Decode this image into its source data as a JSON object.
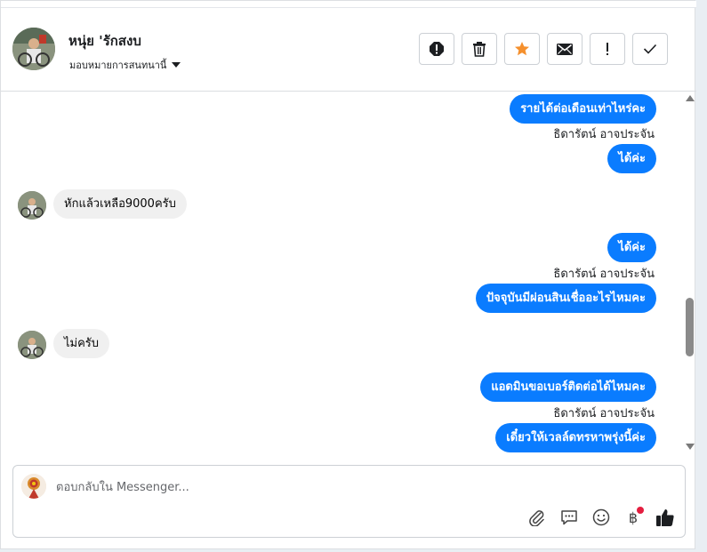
{
  "header": {
    "contact_name": "หนุ่ย 'รักสงบ",
    "assign_label": "มอบหมายการสนทนานี้",
    "actions": [
      {
        "icon": "spam-icon"
      },
      {
        "icon": "trash-icon"
      },
      {
        "icon": "star-icon"
      },
      {
        "icon": "mail-icon"
      },
      {
        "icon": "exclamation-icon"
      },
      {
        "icon": "check-icon"
      }
    ]
  },
  "messages": [
    {
      "direction": "out",
      "text": "รายได้ต่อเดือนเท่าไหร่คะ"
    },
    {
      "direction": "sender",
      "text": "ธิดารัตน์ อาจประจัน"
    },
    {
      "direction": "out",
      "text": "ได้ค่ะ"
    },
    {
      "direction": "in",
      "text": "หักแล้วเหลือ9000ครับ"
    },
    {
      "direction": "out",
      "text": "ได้ค่ะ"
    },
    {
      "direction": "sender",
      "text": "ธิดารัตน์ อาจประจัน"
    },
    {
      "direction": "out",
      "text": "ปัจจุบันมีผ่อนสินเชื่ออะไรไหมคะ"
    },
    {
      "direction": "in",
      "text": "ไม่ครับ"
    },
    {
      "direction": "out",
      "text": "แอดมินขอเบอร์ติดต่อได้ไหมคะ"
    },
    {
      "direction": "sender",
      "text": "ธิดารัตน์ อาจประจัน"
    },
    {
      "direction": "out",
      "text": "เดี๋ยวให้เวลล์ดทรหาพรุ่งนี้ค่ะ"
    }
  ],
  "composer": {
    "placeholder": "ตอบกลับใน Messenger...",
    "value": "",
    "currency_symbol": "฿",
    "tools": [
      "paperclip-icon",
      "saved-reply-icon",
      "emoji-icon",
      "baht-icon",
      "thumbs-up-icon"
    ]
  },
  "colors": {
    "outgoing_bubble": "#0a7cff",
    "incoming_bubble": "#f0f0f0",
    "star_active": "#f5902d",
    "notification_dot": "#e41e3f"
  }
}
